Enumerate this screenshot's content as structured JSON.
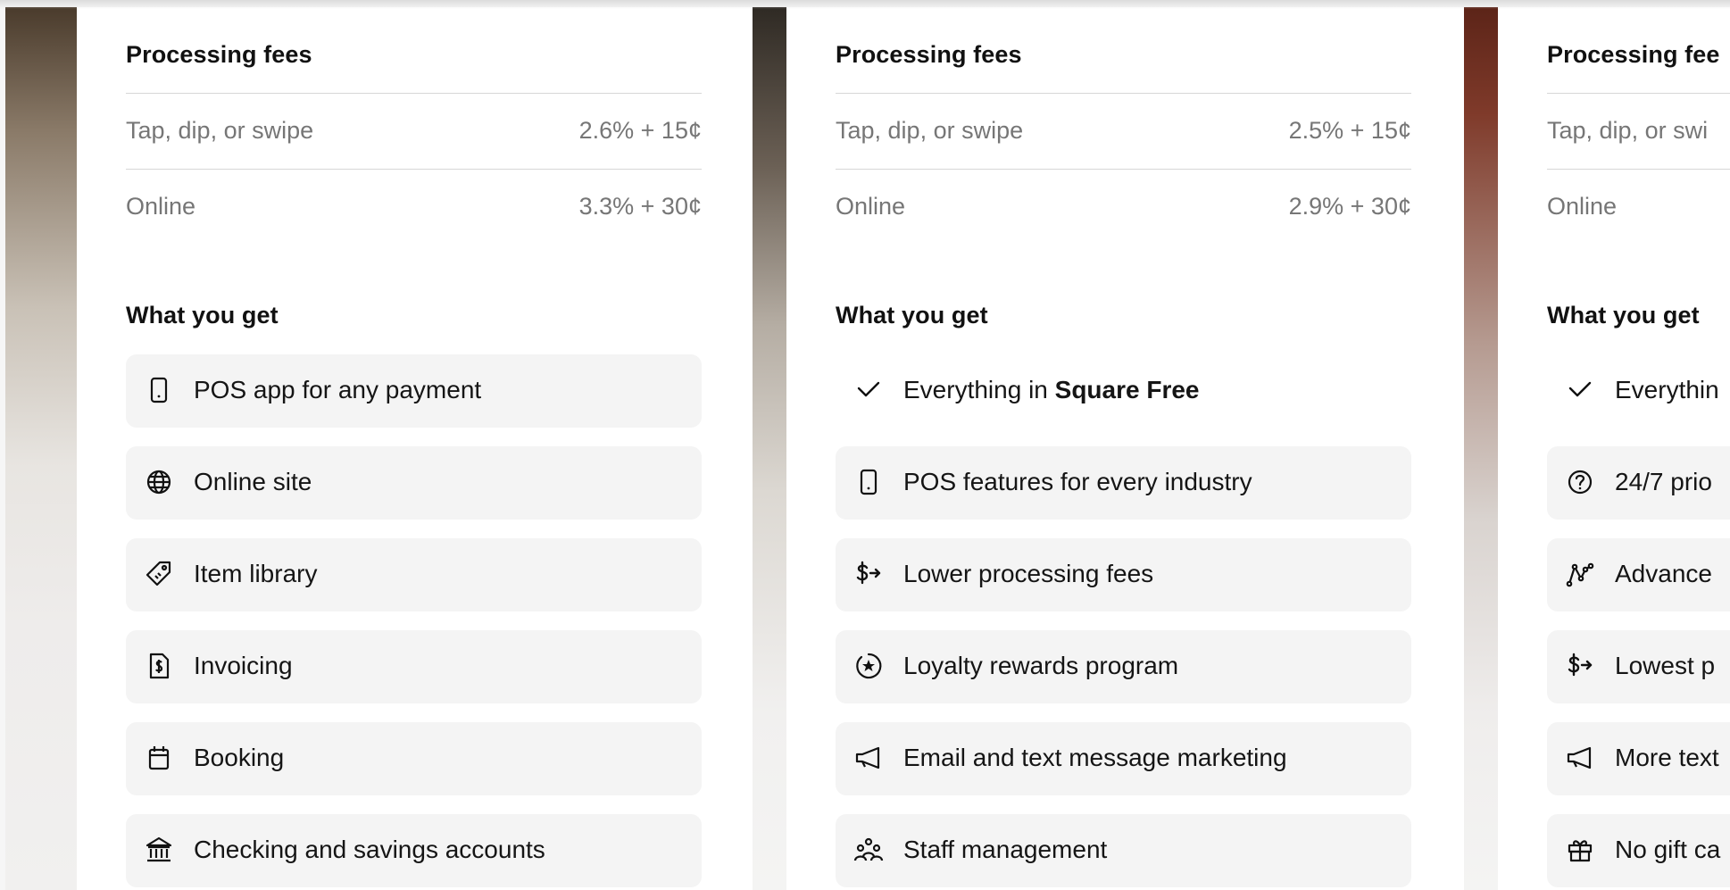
{
  "cards": [
    {
      "fees_title": "Processing fees",
      "fees": [
        {
          "label": "Tap, dip, or swipe",
          "value": "2.6% + 15¢"
        },
        {
          "label": "Online",
          "value": "3.3% + 30¢"
        }
      ],
      "features_title": "What you get",
      "features": [
        {
          "icon": "phone-icon",
          "text": "POS app for any payment"
        },
        {
          "icon": "globe-icon",
          "text": "Online site"
        },
        {
          "icon": "tag-icon",
          "text": "Item library"
        },
        {
          "icon": "invoice-icon",
          "text": "Invoicing"
        },
        {
          "icon": "calendar-icon",
          "text": "Booking"
        },
        {
          "icon": "bank-icon",
          "text": "Checking and savings accounts"
        }
      ]
    },
    {
      "fees_title": "Processing fees",
      "fees": [
        {
          "label": "Tap, dip, or swipe",
          "value": "2.5% + 15¢"
        },
        {
          "label": "Online",
          "value": "2.9% + 30¢"
        }
      ],
      "features_title": "What you get",
      "features": [
        {
          "icon": "checkmark-icon",
          "text": "Everything in ",
          "bold": "Square Free"
        },
        {
          "icon": "phone-icon",
          "text": "POS features for every industry"
        },
        {
          "icon": "dollar-arrow-icon",
          "text": "Lower processing fees"
        },
        {
          "icon": "star-badge-icon",
          "text": "Loyalty rewards program"
        },
        {
          "icon": "megaphone-icon",
          "text": "Email and text message marketing"
        },
        {
          "icon": "people-icon",
          "text": "Staff management"
        }
      ]
    },
    {
      "fees_title": "Processing fee",
      "fees": [
        {
          "label": "Tap, dip, or swi",
          "value": ""
        },
        {
          "label": "Online",
          "value": ""
        }
      ],
      "features_title": "What you get",
      "features": [
        {
          "icon": "checkmark-icon",
          "text": "Everythin"
        },
        {
          "icon": "question-circle-icon",
          "text": "24/7 prio"
        },
        {
          "icon": "analytics-icon",
          "text": "Advance"
        },
        {
          "icon": "dollar-arrow-icon",
          "text": "Lowest p"
        },
        {
          "icon": "megaphone-icon",
          "text": "More text"
        },
        {
          "icon": "gift-icon",
          "text": "No gift ca"
        }
      ]
    }
  ]
}
